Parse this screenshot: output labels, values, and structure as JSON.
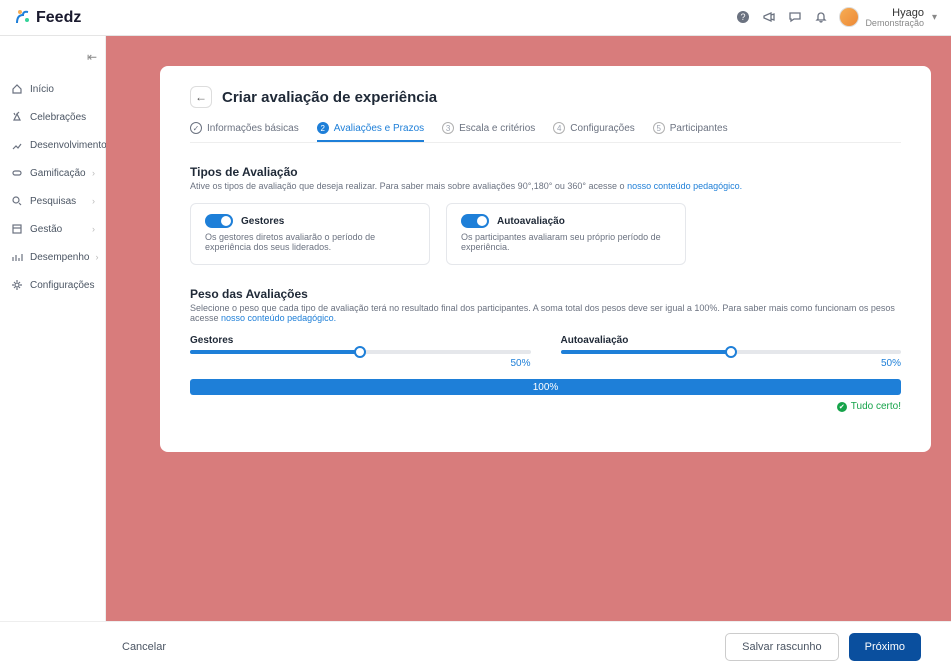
{
  "brand": {
    "name": "Feedz"
  },
  "user": {
    "name": "Hyago",
    "subtitle": "Demonstração"
  },
  "sidebar": {
    "items": [
      {
        "label": "Início",
        "expandable": false,
        "icon": "home"
      },
      {
        "label": "Celebrações",
        "expandable": false,
        "icon": "party"
      },
      {
        "label": "Desenvolvimento",
        "expandable": true,
        "icon": "growth"
      },
      {
        "label": "Gamificação",
        "expandable": true,
        "icon": "game"
      },
      {
        "label": "Pesquisas",
        "expandable": true,
        "icon": "search"
      },
      {
        "label": "Gestão",
        "expandable": true,
        "icon": "manage"
      },
      {
        "label": "Desempenho",
        "expandable": true,
        "icon": "perf"
      },
      {
        "label": "Configurações",
        "expandable": false,
        "icon": "gear"
      }
    ]
  },
  "page": {
    "title": "Criar avaliação de experiência",
    "steps": [
      {
        "num": "1",
        "label": "Informações básicas",
        "state": "done"
      },
      {
        "num": "2",
        "label": "Avaliações e Prazos",
        "state": "active"
      },
      {
        "num": "3",
        "label": "Escala e critérios",
        "state": "todo"
      },
      {
        "num": "4",
        "label": "Configurações",
        "state": "todo"
      },
      {
        "num": "5",
        "label": "Participantes",
        "state": "todo"
      }
    ],
    "types": {
      "title": "Tipos de Avaliação",
      "desc_prefix": "Ative os tipos de avaliação que deseja realizar. Para saber mais sobre avaliações 90°,180° ou 360° acesse o ",
      "desc_link": "nosso conteúdo pedagógico.",
      "cards": [
        {
          "title": "Gestores",
          "desc": "Os gestores diretos avaliarão o período de experiência dos seus liderados.",
          "on": true
        },
        {
          "title": "Autoavaliação",
          "desc": "Os participantes avaliaram seu próprio período de experiência.",
          "on": true
        }
      ]
    },
    "weights": {
      "title": "Peso das Avaliações",
      "desc_prefix": "Selecione o peso que cada tipo de avaliação terá no resultado final dos participantes. A soma total dos pesos deve ser igual a 100%. Para saber mais como funcionam os pesos acesse ",
      "desc_link": "nosso conteúdo pedagógico.",
      "cols": [
        {
          "label": "Gestores",
          "value": 50,
          "display": "50%"
        },
        {
          "label": "Autoavaliação",
          "value": 50,
          "display": "50%"
        }
      ],
      "total_display": "100%",
      "status": "Tudo certo!"
    }
  },
  "actions": {
    "cancel": "Cancelar",
    "draft": "Salvar rascunho",
    "next": "Próximo"
  }
}
